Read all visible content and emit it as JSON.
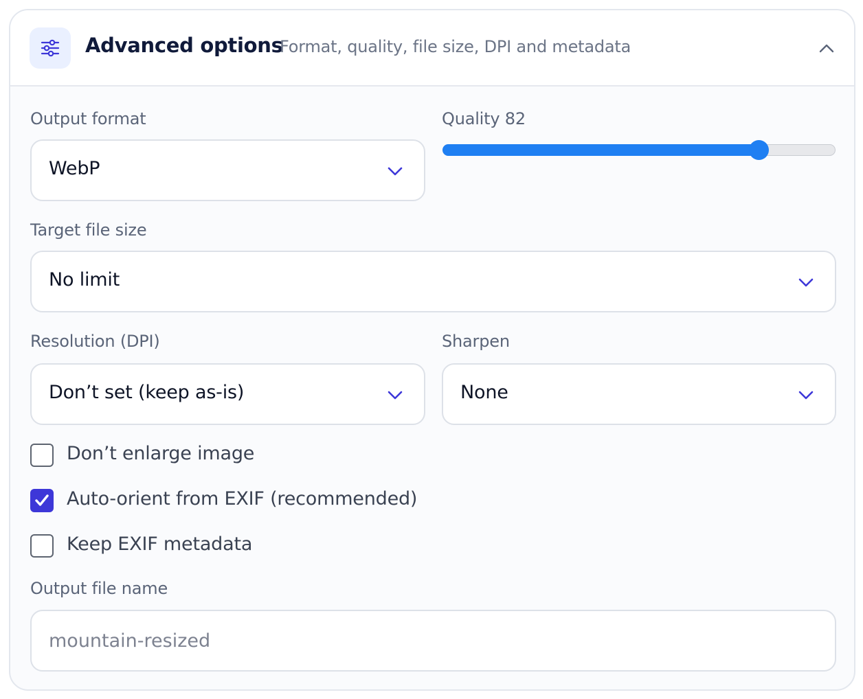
{
  "header": {
    "icon": "sliders-icon",
    "title": "Advanced options",
    "subtitle": "Format, quality, file size, DPI and metadata",
    "collapse_icon": "chevron-up-icon"
  },
  "output_format": {
    "label": "Output format",
    "value": "WebP"
  },
  "quality": {
    "label": "Quality 82",
    "value": 82,
    "min": 0,
    "max": 100
  },
  "target_size": {
    "label": "Target file size",
    "value": "No limit"
  },
  "resolution": {
    "label": "Resolution (DPI)",
    "value": "Don’t set (keep as-is)"
  },
  "sharpen": {
    "label": "Sharpen",
    "value": "None"
  },
  "checkboxes": [
    {
      "label": "Don’t enlarge image",
      "checked": false
    },
    {
      "label": "Auto-orient from EXIF (recommended)",
      "checked": true
    },
    {
      "label": "Keep EXIF metadata",
      "checked": false
    }
  ],
  "file_name": {
    "label": "Output file name",
    "placeholder": "mountain-resized"
  },
  "colors": {
    "accent": "#1f7ff2",
    "checkbox_accent": "#3d37d8",
    "chevron": "#3d37d8",
    "title": "#101a3a"
  }
}
